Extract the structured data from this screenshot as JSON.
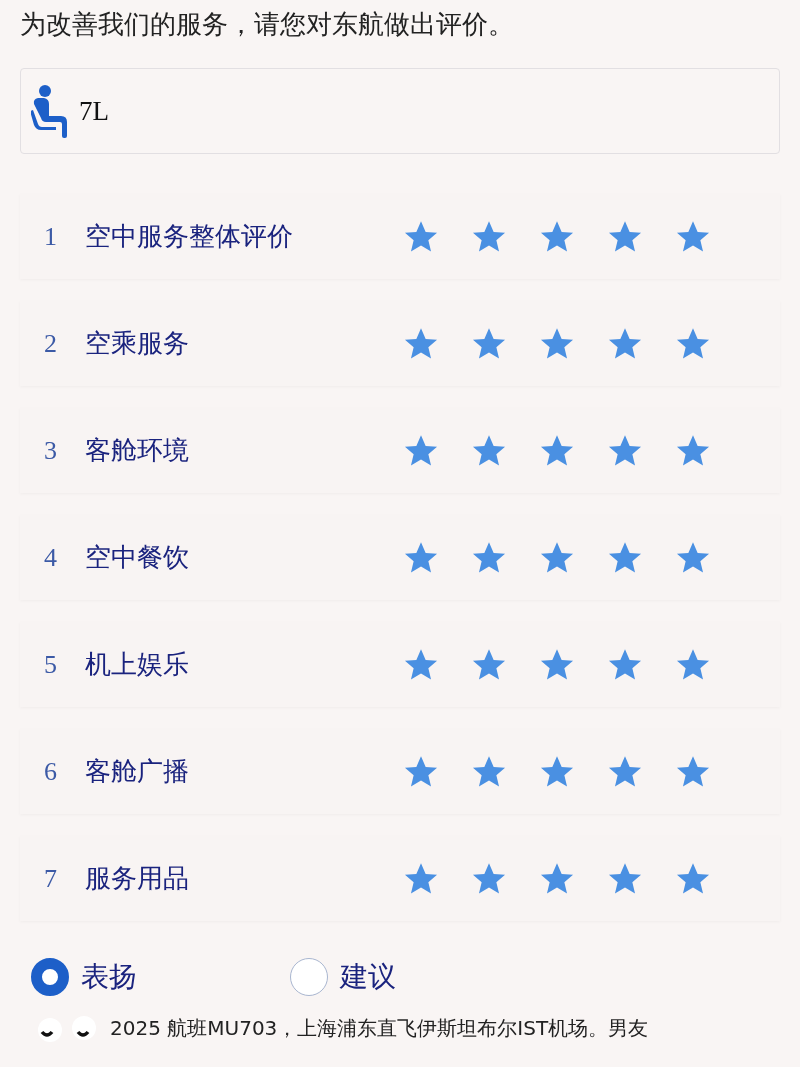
{
  "heading": "为改善我们的服务，请您对东航做出评价。",
  "seat": {
    "value": "7L"
  },
  "ratings": [
    {
      "number": "1",
      "label": "空中服务整体评价",
      "stars": 5
    },
    {
      "number": "2",
      "label": "空乘服务",
      "stars": 5
    },
    {
      "number": "3",
      "label": "客舱环境",
      "stars": 5
    },
    {
      "number": "4",
      "label": "空中餐饮",
      "stars": 5
    },
    {
      "number": "5",
      "label": "机上娱乐",
      "stars": 5
    },
    {
      "number": "6",
      "label": "客舱广播",
      "stars": 5
    },
    {
      "number": "7",
      "label": "服务用品",
      "stars": 5
    }
  ],
  "feedback_type": [
    {
      "label": "表扬",
      "selected": true
    },
    {
      "label": "建议",
      "selected": false
    }
  ],
  "comment": "2025 航班MU703，上海浦东直飞伊斯坦布尔IST机场。男友"
}
